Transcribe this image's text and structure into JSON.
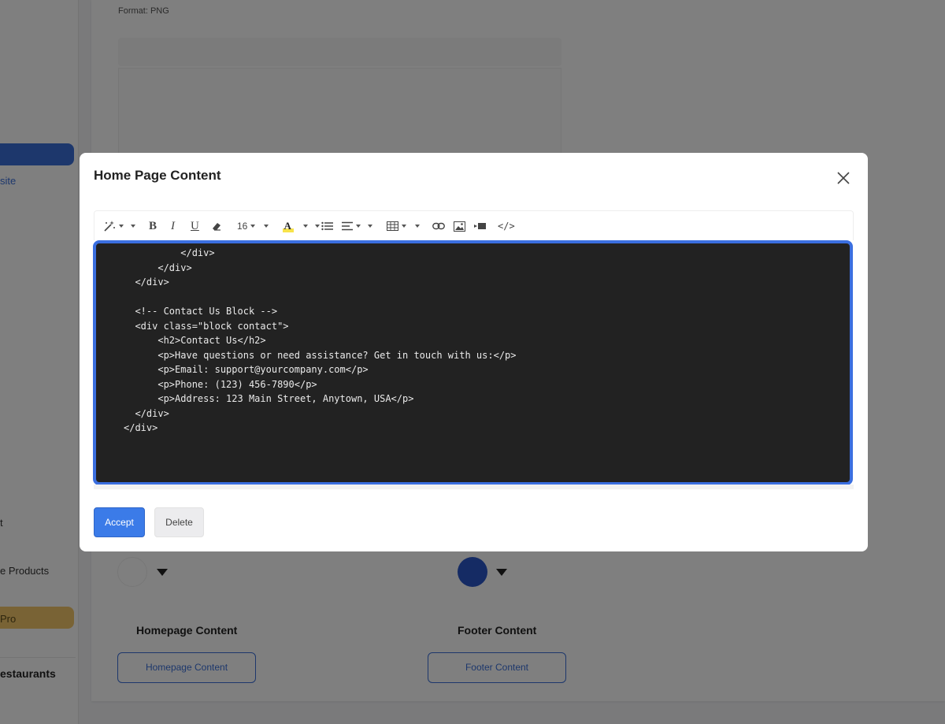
{
  "background": {
    "sidebar": {
      "link_partial": "site",
      "item_partial_1": "t",
      "item_partial_2": "e Products",
      "pro_partial": "Pro",
      "restaurants_partial": "estaurants"
    },
    "format_label": "Format: PNG",
    "homepage_section": {
      "title": "Homepage Content",
      "button": "Homepage Content"
    },
    "footer_section": {
      "title": "Footer Content",
      "button": "Footer Content"
    },
    "colors": {
      "swatch_left": "#ffffff",
      "swatch_right": "#2a57c9"
    }
  },
  "modal": {
    "title": "Home Page Content",
    "toolbar": {
      "font_size": "16",
      "buttons": [
        "magic-wand",
        "bold",
        "italic",
        "underline",
        "eraser",
        "font-size",
        "highlight",
        "list",
        "align",
        "table",
        "link",
        "image",
        "video",
        "code-view"
      ]
    },
    "code_lines": [
      "          </div>",
      "      </div>",
      "  </div>",
      "",
      "  <!-- Contact Us Block -->",
      "  <div class=\"block contact\">",
      "      <h2>Contact Us</h2>",
      "      <p>Have questions or need assistance? Get in touch with us:</p>",
      "      <p>Email: support@yourcompany.com</p>",
      "      <p>Phone: (123) 456-7890</p>",
      "      <p>Address: 123 Main Street, Anytown, USA</p>",
      "  </div>",
      "</div>"
    ],
    "accept_label": "Accept",
    "delete_label": "Delete",
    "accent_color": "#3b6fe0"
  }
}
